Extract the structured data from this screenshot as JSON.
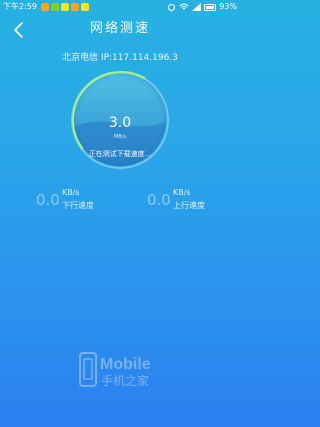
{
  "status_bar": {
    "time": "下午2:59",
    "battery": "93%"
  },
  "header": {
    "title": "网络测速",
    "back_icon": "chevron-left-icon"
  },
  "isp_info": "北京电信 IP:117.114.196.3",
  "gauge": {
    "speed": "3.0",
    "unit": "MB/s",
    "status": "正在测试下载速度..."
  },
  "download": {
    "value": "0.0",
    "unit": "KB/s",
    "label": "下行速度"
  },
  "upload": {
    "value": "0.0",
    "unit": "KB/s",
    "label": "上行速度"
  },
  "watermark": {
    "text_top": "Mobile",
    "text_bottom": "手机之家"
  }
}
